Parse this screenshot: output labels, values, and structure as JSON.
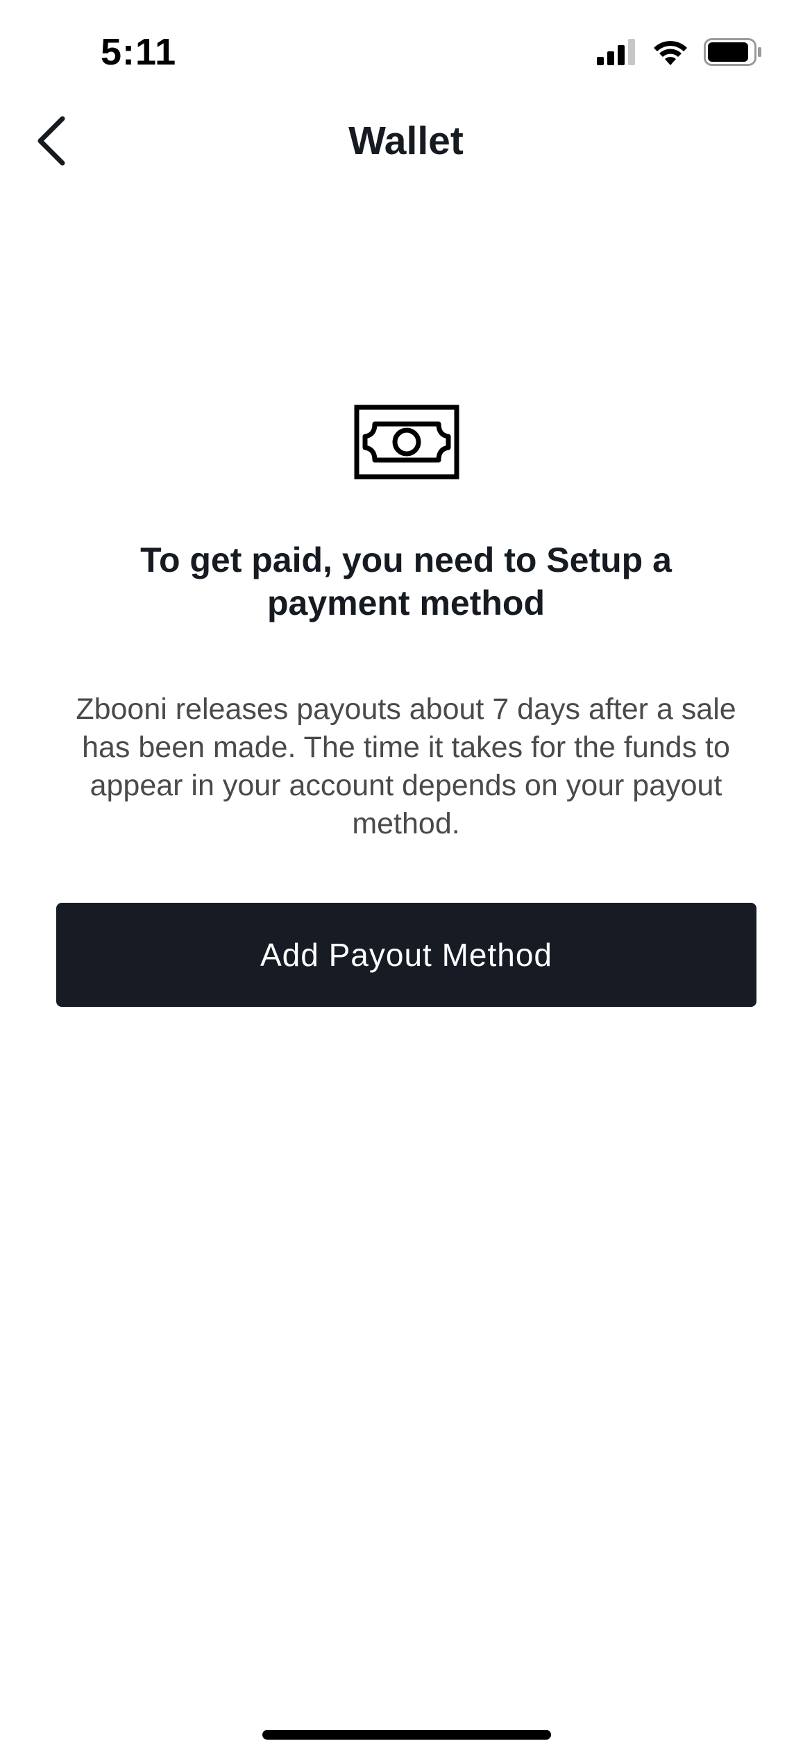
{
  "status_bar": {
    "time": "5:11"
  },
  "header": {
    "title": "Wallet",
    "back_icon": "chevron-left-icon"
  },
  "empty_state": {
    "icon": "banknote-icon",
    "headline": "To get paid, you need to Setup a payment method",
    "description": "Zbooni releases payouts about 7 days after a sale has been made. The time it takes for the funds to appear in your account depends on your payout method.",
    "button_label": "Add Payout Method"
  },
  "colors": {
    "primary": "#161b24",
    "text": "#161b22",
    "muted_text": "#4a4a4a",
    "background": "#ffffff"
  }
}
